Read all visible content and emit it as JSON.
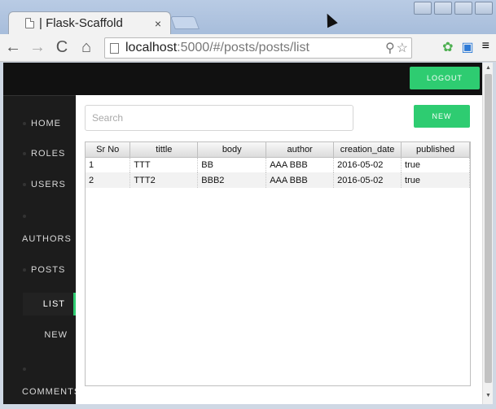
{
  "browser": {
    "tab_title": "| Flask-Scaffold",
    "tab_close": "×",
    "url_host": "localhost",
    "url_rest": ":5000/#/posts/posts/list",
    "back": "←",
    "forward": "→",
    "reload": "C",
    "home": "⌂",
    "menu": "≡"
  },
  "header": {
    "logout_label": "LOGOUT"
  },
  "sidebar": {
    "items": [
      {
        "label": "HOME"
      },
      {
        "label": "ROLES"
      },
      {
        "label": "USERS"
      },
      {
        "label": "AUTHORS"
      },
      {
        "label": "POSTS"
      },
      {
        "label": "COMMENTS"
      }
    ],
    "subitems": [
      {
        "label": "LIST",
        "active": true
      },
      {
        "label": "NEW",
        "active": false
      }
    ]
  },
  "main": {
    "search_placeholder": "Search",
    "new_label": "NEW",
    "columns": [
      "Sr No",
      "tittle",
      "body",
      "author",
      "creation_date",
      "published"
    ],
    "rows": [
      [
        "1",
        "TTT",
        "BB",
        "AAA BBB",
        "2016-05-02",
        "true"
      ],
      [
        "2",
        "TTT2",
        "BBB2",
        "AAA BBB",
        "2016-05-02",
        "true"
      ]
    ]
  },
  "colors": {
    "accent": "#2ecc71",
    "sidebar": "#1c1c1c",
    "topbar": "#111111"
  }
}
